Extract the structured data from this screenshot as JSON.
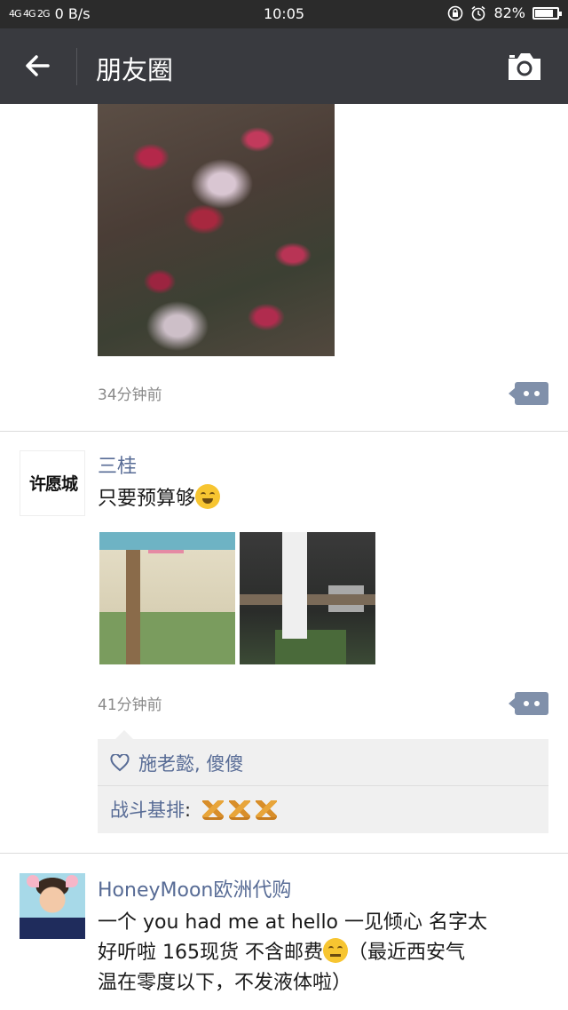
{
  "status_bar": {
    "signal": "4G 4G 2G",
    "speed": "0 B/s",
    "time": "10:05",
    "battery": "82%",
    "battery_level": 0.82
  },
  "nav": {
    "title": "朋友圈",
    "back_icon": "arrow-left-icon",
    "camera_icon": "camera-icon"
  },
  "posts": [
    {
      "time": "34分钟前"
    },
    {
      "author": "三桂",
      "avatar_text": "许愿城",
      "text": "只要预算够",
      "time": "41分钟前",
      "likes": "施老懿, 傻傻",
      "comments": [
        {
          "name": "战斗基排",
          "text": ": "
        }
      ]
    },
    {
      "author": "HoneyMoon欧洲代购",
      "text_line1": "一个 you had me at hello 一见倾心 名字太",
      "text_line2a": "好听啦 165现货 不含邮费",
      "text_line2b": "（最近西安气",
      "text_line3": "温在零度以下，不发液体啦）"
    }
  ],
  "colors": {
    "nav_bg": "#393a3f",
    "status_bg": "#2b2b2b",
    "link_blue": "#576b95",
    "comment_btn": "#8090aa"
  }
}
